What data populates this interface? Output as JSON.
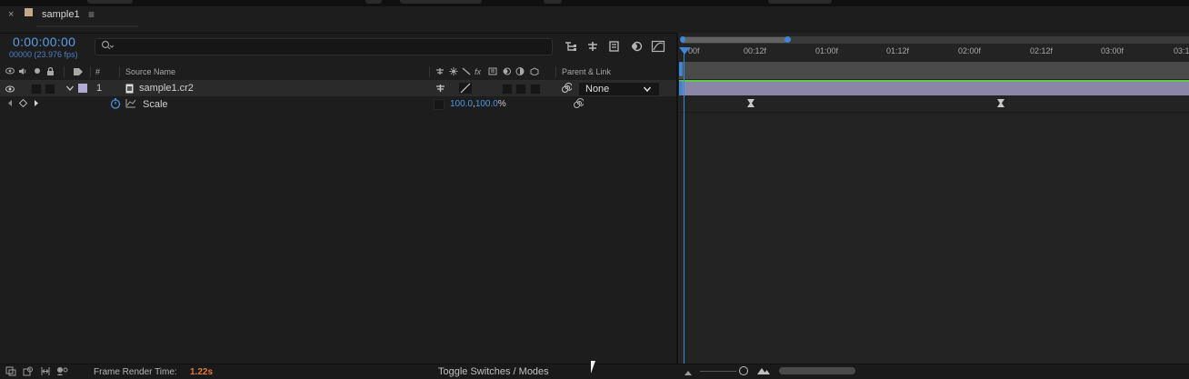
{
  "panel": {
    "close_glyph": "×",
    "tab_title": "sample1",
    "menu_glyph": "≡"
  },
  "timeline": {
    "timecode": "0:00:00:00",
    "frame_fps": "00000 (23.976 fps)",
    "search_placeholder": ""
  },
  "columns": {
    "number": "#",
    "source_name": "Source Name",
    "switches": "fx",
    "parent_link": "Parent & Link"
  },
  "layer": {
    "index": "1",
    "name": "sample1.cr2",
    "parent": "None"
  },
  "property": {
    "name": "Scale",
    "value_a": "100.0",
    "value_sep": ",",
    "value_b": "100.0",
    "unit": "%"
  },
  "ruler": {
    "ticks": [
      "00f",
      "00:12f",
      "01:00f",
      "01:12f",
      "02:00f",
      "02:12f",
      "03:00f",
      "03:1"
    ]
  },
  "footer": {
    "render_label": "Frame Render Time:",
    "render_value": "1.22s",
    "toggle_label": "Toggle Switches / Modes"
  },
  "colors": {
    "accent_blue": "#5a9ee8",
    "layer_bar": "#8b86a6",
    "render_value": "#e07a3a",
    "label_swatch": "#b0a9d4"
  }
}
